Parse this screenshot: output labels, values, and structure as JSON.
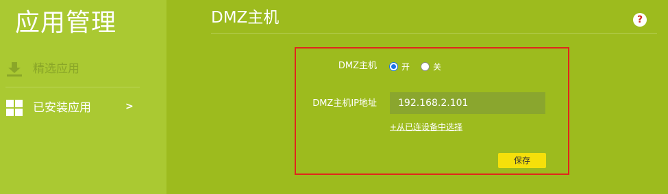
{
  "sidebar": {
    "title": "应用管理",
    "items": [
      {
        "label": "精选应用",
        "icon": "download-icon"
      },
      {
        "label": "已安装应用",
        "icon": "grid-icon",
        "chevron": ">"
      }
    ]
  },
  "main": {
    "title": "DMZ主机",
    "help_icon": "?"
  },
  "form": {
    "dmz_label": "DMZ主机",
    "radio_on_label": "开",
    "radio_off_label": "关",
    "ip_label": "DMZ主机IP地址",
    "ip_value": "192.168.2.101",
    "pick_link": "+从已连设备中选择",
    "save_label": "保存"
  },
  "colors": {
    "sidebar_bg": "#aac932",
    "main_bg": "#9dbb1e",
    "highlight_border": "#e1251b",
    "save_button": "#f5e00a",
    "radio_selected": "#1a73e8"
  }
}
